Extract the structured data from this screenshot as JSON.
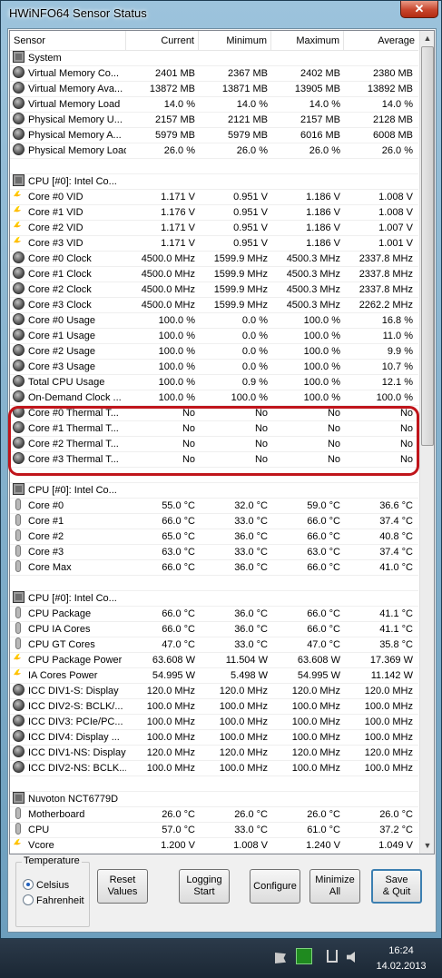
{
  "window": {
    "title": "HWiNFO64 Sensor Status",
    "close_glyph": "✕"
  },
  "columns": [
    "Sensor",
    "Current",
    "Minimum",
    "Maximum",
    "Average"
  ],
  "rows": [
    {
      "icon": "chip",
      "label": "System",
      "values": [
        "",
        "",
        "",
        ""
      ]
    },
    {
      "icon": "gauge",
      "label": "Virtual Memory Co...",
      "values": [
        "2401 MB",
        "2367 MB",
        "2402 MB",
        "2380 MB"
      ]
    },
    {
      "icon": "gauge",
      "label": "Virtual Memory Ava...",
      "values": [
        "13872 MB",
        "13871 MB",
        "13905 MB",
        "13892 MB"
      ]
    },
    {
      "icon": "gauge",
      "label": "Virtual Memory Load",
      "values": [
        "14.0 %",
        "14.0 %",
        "14.0 %",
        "14.0 %"
      ]
    },
    {
      "icon": "gauge",
      "label": "Physical Memory U...",
      "values": [
        "2157 MB",
        "2121 MB",
        "2157 MB",
        "2128 MB"
      ]
    },
    {
      "icon": "gauge",
      "label": "Physical Memory A...",
      "values": [
        "5979 MB",
        "5979 MB",
        "6016 MB",
        "6008 MB"
      ]
    },
    {
      "icon": "gauge",
      "label": "Physical Memory Load",
      "values": [
        "26.0 %",
        "26.0 %",
        "26.0 %",
        "26.0 %"
      ]
    },
    {
      "icon": "",
      "label": "",
      "values": [
        "",
        "",
        "",
        ""
      ]
    },
    {
      "icon": "chip",
      "label": "CPU [#0]: Intel Co...",
      "values": [
        "",
        "",
        "",
        ""
      ]
    },
    {
      "icon": "bolt",
      "label": "Core #0 VID",
      "values": [
        "1.171 V",
        "0.951 V",
        "1.186 V",
        "1.008 V"
      ]
    },
    {
      "icon": "bolt",
      "label": "Core #1 VID",
      "values": [
        "1.176 V",
        "0.951 V",
        "1.186 V",
        "1.008 V"
      ]
    },
    {
      "icon": "bolt",
      "label": "Core #2 VID",
      "values": [
        "1.171 V",
        "0.951 V",
        "1.186 V",
        "1.007 V"
      ]
    },
    {
      "icon": "bolt",
      "label": "Core #3 VID",
      "values": [
        "1.171 V",
        "0.951 V",
        "1.186 V",
        "1.001 V"
      ]
    },
    {
      "icon": "gauge",
      "label": "Core #0 Clock",
      "values": [
        "4500.0 MHz",
        "1599.9 MHz",
        "4500.3 MHz",
        "2337.8 MHz"
      ]
    },
    {
      "icon": "gauge",
      "label": "Core #1 Clock",
      "values": [
        "4500.0 MHz",
        "1599.9 MHz",
        "4500.3 MHz",
        "2337.8 MHz"
      ]
    },
    {
      "icon": "gauge",
      "label": "Core #2 Clock",
      "values": [
        "4500.0 MHz",
        "1599.9 MHz",
        "4500.3 MHz",
        "2337.8 MHz"
      ]
    },
    {
      "icon": "gauge",
      "label": "Core #3 Clock",
      "values": [
        "4500.0 MHz",
        "1599.9 MHz",
        "4500.3 MHz",
        "2262.2 MHz"
      ]
    },
    {
      "icon": "gauge",
      "label": "Core #0 Usage",
      "values": [
        "100.0 %",
        "0.0 %",
        "100.0 %",
        "16.8 %"
      ]
    },
    {
      "icon": "gauge",
      "label": "Core #1 Usage",
      "values": [
        "100.0 %",
        "0.0 %",
        "100.0 %",
        "11.0 %"
      ]
    },
    {
      "icon": "gauge",
      "label": "Core #2 Usage",
      "values": [
        "100.0 %",
        "0.0 %",
        "100.0 %",
        "9.9 %"
      ]
    },
    {
      "icon": "gauge",
      "label": "Core #3 Usage",
      "values": [
        "100.0 %",
        "0.0 %",
        "100.0 %",
        "10.7 %"
      ]
    },
    {
      "icon": "gauge",
      "label": "Total CPU Usage",
      "values": [
        "100.0 %",
        "0.9 %",
        "100.0 %",
        "12.1 %"
      ]
    },
    {
      "icon": "gauge",
      "label": "On-Demand Clock ...",
      "values": [
        "100.0 %",
        "100.0 %",
        "100.0 %",
        "100.0 %"
      ]
    },
    {
      "icon": "gauge",
      "label": "Core #0 Thermal T...",
      "values": [
        "No",
        "No",
        "No",
        "No"
      ]
    },
    {
      "icon": "gauge",
      "label": "Core #1 Thermal T...",
      "values": [
        "No",
        "No",
        "No",
        "No"
      ]
    },
    {
      "icon": "gauge",
      "label": "Core #2 Thermal T...",
      "values": [
        "No",
        "No",
        "No",
        "No"
      ]
    },
    {
      "icon": "gauge",
      "label": "Core #3 Thermal T...",
      "values": [
        "No",
        "No",
        "No",
        "No"
      ]
    },
    {
      "icon": "",
      "label": "",
      "values": [
        "",
        "",
        "",
        ""
      ]
    },
    {
      "icon": "chip",
      "label": "CPU [#0]: Intel Co...",
      "values": [
        "",
        "",
        "",
        ""
      ]
    },
    {
      "icon": "therm",
      "label": "Core #0",
      "values": [
        "55.0 °C",
        "32.0 °C",
        "59.0 °C",
        "36.6 °C"
      ]
    },
    {
      "icon": "therm",
      "label": "Core #1",
      "values": [
        "66.0 °C",
        "33.0 °C",
        "66.0 °C",
        "37.4 °C"
      ]
    },
    {
      "icon": "therm",
      "label": "Core #2",
      "values": [
        "65.0 °C",
        "36.0 °C",
        "66.0 °C",
        "40.8 °C"
      ]
    },
    {
      "icon": "therm",
      "label": "Core #3",
      "values": [
        "63.0 °C",
        "33.0 °C",
        "63.0 °C",
        "37.4 °C"
      ]
    },
    {
      "icon": "therm",
      "label": "Core Max",
      "values": [
        "66.0 °C",
        "36.0 °C",
        "66.0 °C",
        "41.0 °C"
      ]
    },
    {
      "icon": "",
      "label": "",
      "values": [
        "",
        "",
        "",
        ""
      ]
    },
    {
      "icon": "chip",
      "label": "CPU [#0]: Intel Co...",
      "values": [
        "",
        "",
        "",
        ""
      ]
    },
    {
      "icon": "therm",
      "label": "CPU Package",
      "values": [
        "66.0 °C",
        "36.0 °C",
        "66.0 °C",
        "41.1 °C"
      ]
    },
    {
      "icon": "therm",
      "label": "CPU IA Cores",
      "values": [
        "66.0 °C",
        "36.0 °C",
        "66.0 °C",
        "41.1 °C"
      ]
    },
    {
      "icon": "therm",
      "label": "CPU GT Cores",
      "values": [
        "47.0 °C",
        "33.0 °C",
        "47.0 °C",
        "35.8 °C"
      ]
    },
    {
      "icon": "bolt",
      "label": "CPU Package Power",
      "values": [
        "63.608 W",
        "11.504 W",
        "63.608 W",
        "17.369 W"
      ]
    },
    {
      "icon": "bolt",
      "label": "IA Cores Power",
      "values": [
        "54.995 W",
        "5.498 W",
        "54.995 W",
        "11.142 W"
      ]
    },
    {
      "icon": "gauge",
      "label": "ICC DIV1-S: Display",
      "values": [
        "120.0 MHz",
        "120.0 MHz",
        "120.0 MHz",
        "120.0 MHz"
      ]
    },
    {
      "icon": "gauge",
      "label": "ICC DIV2-S: BCLK/...",
      "values": [
        "100.0 MHz",
        "100.0 MHz",
        "100.0 MHz",
        "100.0 MHz"
      ]
    },
    {
      "icon": "gauge",
      "label": "ICC DIV3: PCIe/PC...",
      "values": [
        "100.0 MHz",
        "100.0 MHz",
        "100.0 MHz",
        "100.0 MHz"
      ]
    },
    {
      "icon": "gauge",
      "label": "ICC DIV4: Display ...",
      "values": [
        "100.0 MHz",
        "100.0 MHz",
        "100.0 MHz",
        "100.0 MHz"
      ]
    },
    {
      "icon": "gauge",
      "label": "ICC DIV1-NS: Display",
      "values": [
        "120.0 MHz",
        "120.0 MHz",
        "120.0 MHz",
        "120.0 MHz"
      ]
    },
    {
      "icon": "gauge",
      "label": "ICC DIV2-NS: BCLK...",
      "values": [
        "100.0 MHz",
        "100.0 MHz",
        "100.0 MHz",
        "100.0 MHz"
      ]
    },
    {
      "icon": "",
      "label": "",
      "values": [
        "",
        "",
        "",
        ""
      ]
    },
    {
      "icon": "chip",
      "label": "Nuvoton NCT6779D",
      "values": [
        "",
        "",
        "",
        ""
      ]
    },
    {
      "icon": "therm",
      "label": "Motherboard",
      "values": [
        "26.0 °C",
        "26.0 °C",
        "26.0 °C",
        "26.0 °C"
      ]
    },
    {
      "icon": "therm",
      "label": "CPU",
      "values": [
        "57.0 °C",
        "33.0 °C",
        "61.0 °C",
        "37.2 °C"
      ]
    },
    {
      "icon": "bolt",
      "label": "Vcore",
      "values": [
        "1.200 V",
        "1.008 V",
        "1.240 V",
        "1.049 V"
      ]
    }
  ],
  "scroll": {
    "up_glyph": "▲",
    "down_glyph": "▼"
  },
  "temperature": {
    "legend": "Temperature",
    "celsius": "Celsius",
    "fahrenheit": "Fahrenheit",
    "selected": "Celsius"
  },
  "buttons": {
    "reset": "Reset\nValues",
    "logging": "Logging\nStart",
    "configure": "Configure",
    "minimize": "Minimize\nAll",
    "save": "Save\n& Quit"
  },
  "taskbar": {
    "time": "16:24",
    "date": "14.02.2013"
  },
  "colors": {
    "highlight": "#c0151b",
    "accent": "#3c7fb1"
  }
}
